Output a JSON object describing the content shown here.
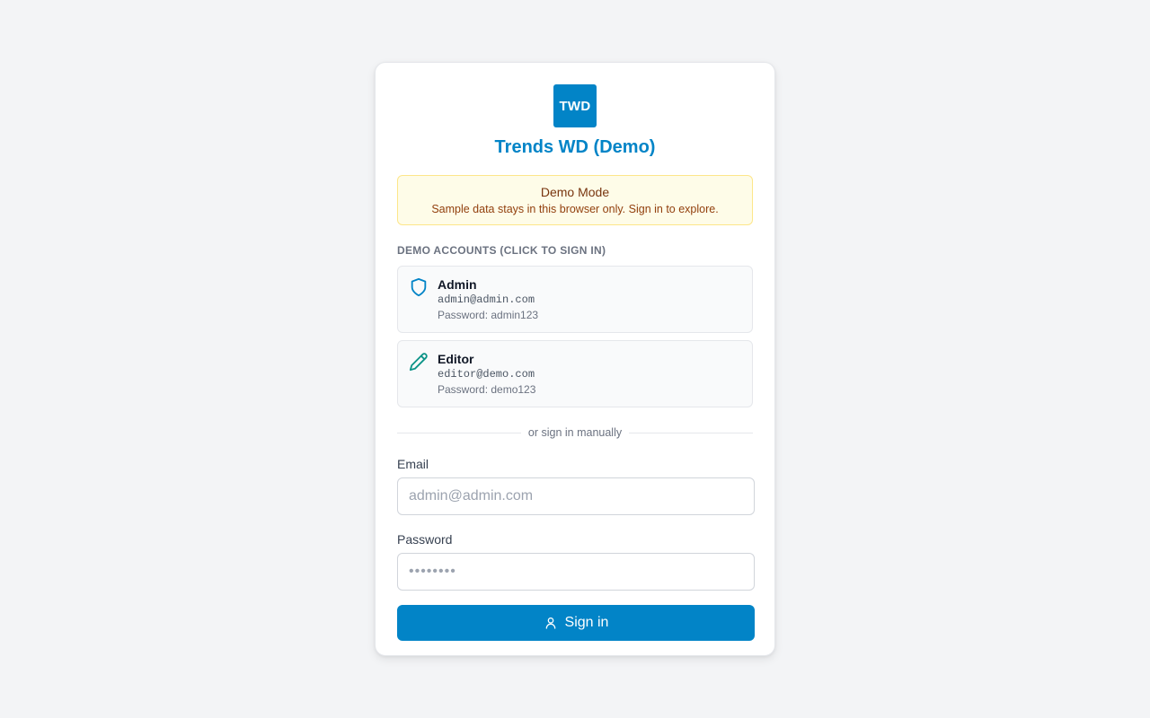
{
  "brand": {
    "logo_text": "TWD",
    "title": "Trends WD (Demo)",
    "accent_color": "#0284c7"
  },
  "banner": {
    "title": "Demo Mode",
    "text": "Sample data stays in this browser only. Sign in to explore."
  },
  "demo_accounts": {
    "label": "DEMO ACCOUNTS (CLICK TO SIGN IN)",
    "items": [
      {
        "icon": "shield-icon",
        "icon_color": "#0284c7",
        "name": "Admin",
        "email": "admin@admin.com",
        "password_text": "Password: admin123"
      },
      {
        "icon": "pencil-icon",
        "icon_color": "#0d9488",
        "name": "Editor",
        "email": "editor@demo.com",
        "password_text": "Password: demo123"
      }
    ]
  },
  "divider_text": "or sign in manually",
  "form": {
    "email_label": "Email",
    "email_placeholder": "admin@admin.com",
    "email_value": "",
    "password_label": "Password",
    "password_placeholder": "••••••••",
    "password_value": "",
    "submit_label": "Sign in",
    "submit_icon": "user-icon"
  }
}
